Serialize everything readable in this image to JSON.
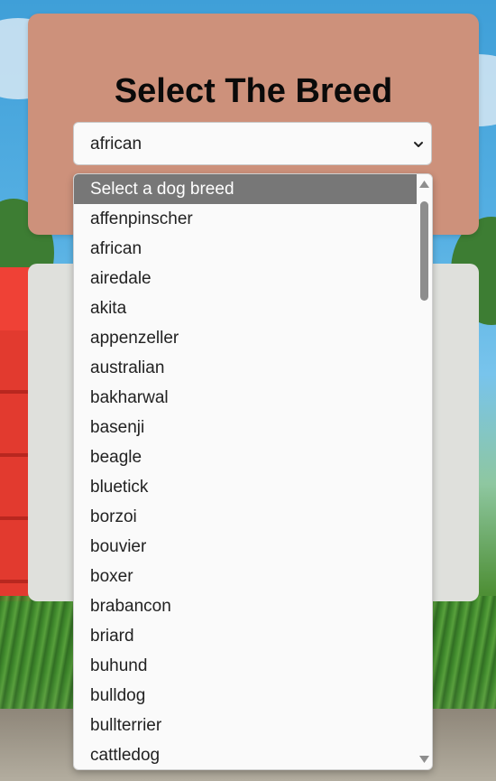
{
  "header": {
    "title": "Select The Breed"
  },
  "breed_select": {
    "value": "african",
    "options": [
      "Select a dog breed",
      "affenpinscher",
      "african",
      "airedale",
      "akita",
      "appenzeller",
      "australian",
      "bakharwal",
      "basenji",
      "beagle",
      "bluetick",
      "borzoi",
      "bouvier",
      "boxer",
      "brabancon",
      "briard",
      "buhund",
      "bulldog",
      "bullterrier",
      "cattledog"
    ],
    "highlighted_index": 0
  },
  "icons": {
    "select_chevron": "chevron-down-icon",
    "scroll_up": "scroll-up-arrow-icon",
    "scroll_down": "scroll-down-arrow-icon"
  },
  "colors": {
    "header_card": "#cd917b",
    "content_card": "#dfe0dc",
    "highlight": "#777777"
  }
}
